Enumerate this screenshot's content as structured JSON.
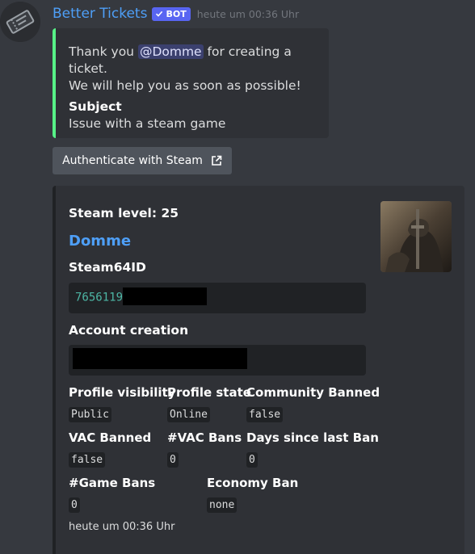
{
  "message": {
    "username": "Better Tickets",
    "bot_tag": "BOT",
    "timestamp": "heute um 00:36 Uhr",
    "colors": {
      "username": "#4e9ff7",
      "bot_tag_bg": "#5865f2",
      "embed_accent": "#57f287"
    }
  },
  "embed1": {
    "desc_prefix": "Thank you ",
    "mention": "@Domme",
    "desc_suffix": " for creating a ticket.",
    "desc_line2": "We will help you as soon as possible!",
    "field_name": "Subject",
    "field_value": "Issue with a steam game"
  },
  "button": {
    "label": "Authenticate with Steam",
    "icon": "external-link-icon"
  },
  "embed2": {
    "steam_level": "Steam level: 25",
    "author": "Domme",
    "steam64_label": "Steam64ID",
    "steam64_value": "7656119",
    "account_creation_label": "Account creation",
    "profile_visibility_label": "Profile visibility",
    "profile_visibility_value": "Public",
    "profile_state_label": "Profile state",
    "profile_state_value": "Online",
    "community_banned_label": "Community Banned",
    "community_banned_value": "false",
    "vac_banned_label": "VAC Banned",
    "vac_banned_value": "false",
    "vac_bans_label": "#VAC Bans",
    "vac_bans_value": "0",
    "days_since_ban_label": "Days since last Ban",
    "days_since_ban_value": "0",
    "game_bans_label": "#Game Bans",
    "game_bans_value": "0",
    "economy_ban_label": "Economy Ban",
    "economy_ban_value": "none",
    "footer": "heute um 00:36 Uhr"
  }
}
